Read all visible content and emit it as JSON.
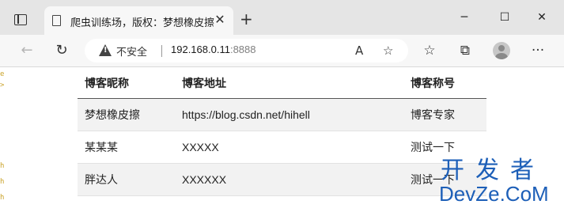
{
  "window": {
    "tab_title": "爬虫训练场，版权：梦想橡皮擦",
    "tab_close": "✕",
    "new_tab": "+",
    "minimize": "─",
    "maximize": "☐",
    "close": "✕"
  },
  "toolbar": {
    "back": "←",
    "reload": "↻",
    "security_text": "不安全",
    "url_host": "192.168.0.11",
    "url_port": ":8888",
    "read_aloud": "A",
    "add_favorite": "☆",
    "favorites": "☆",
    "collections": "⧉",
    "more": "···"
  },
  "table": {
    "headers": [
      "博客昵称",
      "博客地址",
      "博客称号"
    ],
    "rows": [
      [
        "梦想橡皮擦",
        "https://blog.csdn.net/hihell",
        "博客专家"
      ],
      [
        "某某某",
        "XXXXX",
        "测试一下"
      ],
      [
        "胖达人",
        "XXXXXX",
        "测试一下"
      ]
    ]
  },
  "watermark": {
    "top": "开发者",
    "bottom": "DevZe.CoM"
  }
}
